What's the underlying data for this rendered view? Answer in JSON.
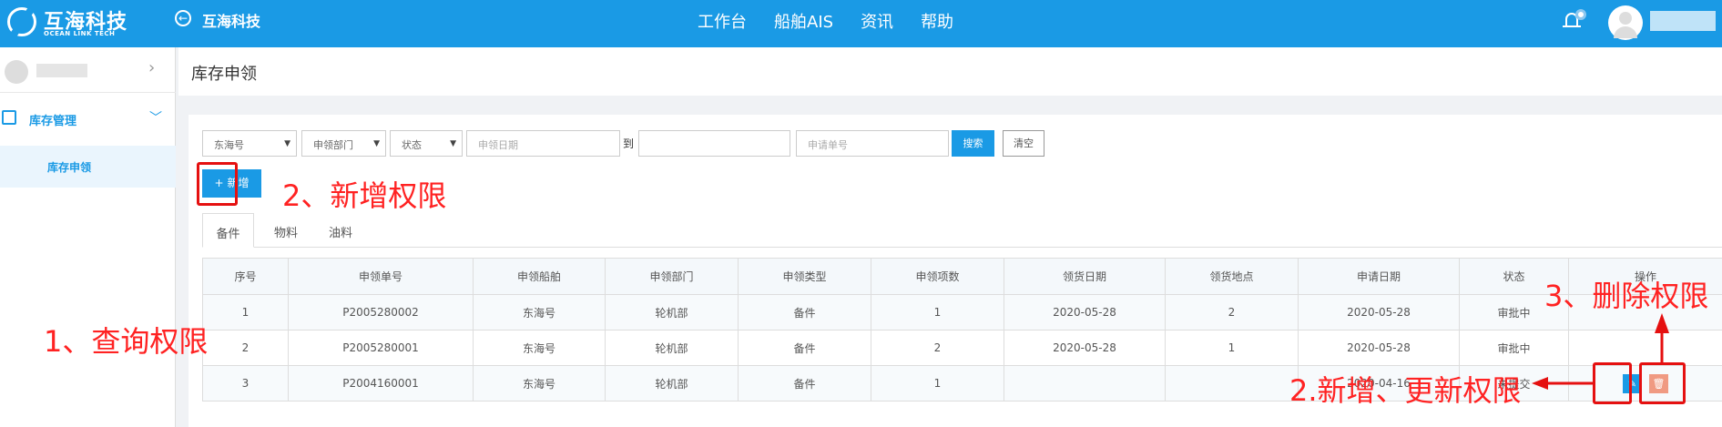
{
  "topbar": {
    "logo_cn": "互海科技",
    "logo_en": "OCEAN LINK TECH",
    "system_title": "互海科技",
    "nav": [
      "工作台",
      "船舶AIS",
      "资讯",
      "帮助"
    ]
  },
  "sidebar": {
    "section_label": "库存管理",
    "item_label": "库存申领"
  },
  "page": {
    "title": "库存申领"
  },
  "filters": {
    "ship": "东海号",
    "department": "申领部门",
    "status": "状态",
    "date_placeholder": "申领日期",
    "to_label": "到",
    "apply_no_placeholder": "申请单号",
    "search_label": "搜索",
    "clear_label": "清空"
  },
  "add_button": "新增",
  "tabs": [
    "备件",
    "物料",
    "油料"
  ],
  "table": {
    "headers": [
      "序号",
      "申领单号",
      "申领船舶",
      "申领部门",
      "申领类型",
      "申领项数",
      "领货日期",
      "领货地点",
      "申请日期",
      "状态",
      "操作"
    ],
    "rows": [
      [
        "1",
        "P2005280002",
        "东海号",
        "轮机部",
        "备件",
        "1",
        "2020-05-28",
        "2",
        "2020-05-28",
        "审批中",
        ""
      ],
      [
        "2",
        "P2005280001",
        "东海号",
        "轮机部",
        "备件",
        "2",
        "2020-05-28",
        "1",
        "2020-05-28",
        "审批中",
        ""
      ],
      [
        "3",
        "P2004160001",
        "东海号",
        "轮机部",
        "备件",
        "1",
        "",
        "",
        "2020-04-16",
        "未提交",
        ""
      ]
    ]
  },
  "annotations": {
    "query": "1、查询权限",
    "add": "2、新增权限",
    "update": "2.新增、更新权限",
    "delete": "3、删除权限"
  },
  "colors": {
    "primary": "#1a9ae5",
    "annotation": "#e51010",
    "delete": "#f09a82"
  },
  "icons": [
    "back-arrow-icon",
    "bell-icon",
    "bag-icon",
    "plus-icon",
    "edit-icon",
    "delete-icon"
  ]
}
